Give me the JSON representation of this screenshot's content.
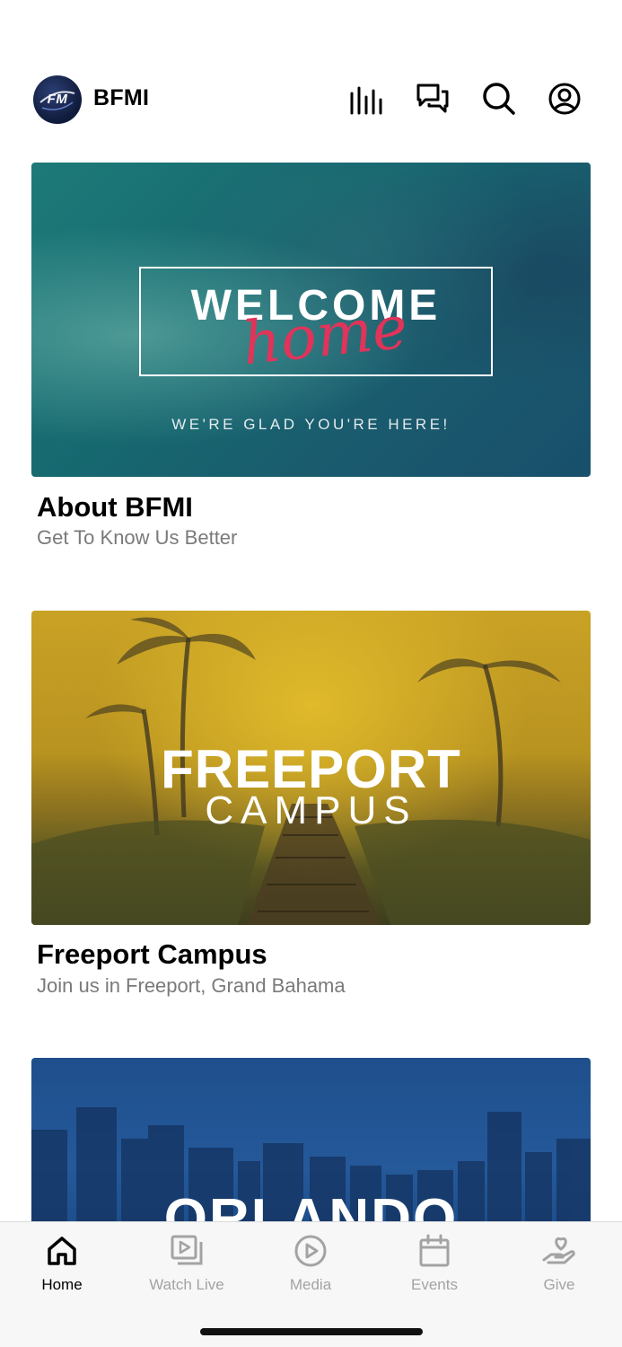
{
  "header": {
    "app_title": "BFMI",
    "logo_text": "FM",
    "icons": [
      "equalizer-icon",
      "chat-bubbles-icon",
      "search-icon",
      "profile-icon"
    ]
  },
  "cards": [
    {
      "title": "About BFMI",
      "subtitle": "Get To Know Us Better",
      "image": {
        "headline": "WELCOME",
        "script": "home",
        "tagline": "WE'RE GLAD YOU'RE HERE!"
      }
    },
    {
      "title": "Freeport Campus",
      "subtitle": "Join us in Freeport, Grand Bahama",
      "image": {
        "headline": "FREEPORT",
        "subline": "CAMPUS"
      }
    },
    {
      "image": {
        "headline": "ORLANDO"
      }
    }
  ],
  "tabbar": {
    "tabs": [
      {
        "label": "Home",
        "icon": "home-icon",
        "active": true
      },
      {
        "label": "Watch Live",
        "icon": "watch-live-icon",
        "active": false
      },
      {
        "label": "Media",
        "icon": "play-circle-icon",
        "active": false
      },
      {
        "label": "Events",
        "icon": "calendar-icon",
        "active": false
      },
      {
        "label": "Give",
        "icon": "give-heart-hand-icon",
        "active": false
      }
    ]
  },
  "colors": {
    "active_tab": "#000000",
    "inactive_tab": "#a3a3a3",
    "subtitle": "#7a7a7a",
    "welcome_script": "#e0345a"
  }
}
